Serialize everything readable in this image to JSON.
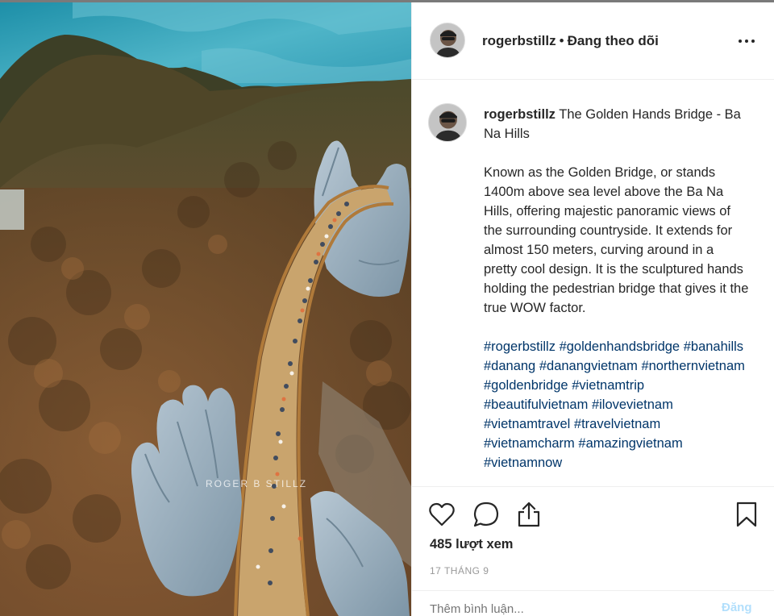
{
  "post": {
    "author": "rogerbstillz",
    "separator": "•",
    "follow_status": "Đang theo dõi",
    "watermark": "ROGER B STILLZ"
  },
  "caption": {
    "username": "rogerbstillz",
    "title": "The Golden Hands Bridge - Ba Na Hills",
    "body": "Known as the Golden Bridge, or stands 1400m above sea level above the Ba Na Hills, offering majestic panoramic views of the surrounding countryside. It extends for almost 150 meters, curving around in a pretty cool design. It is the sculptured hands holding the pedestrian bridge that gives it the true WOW factor.",
    "hashtags": [
      "#rogerbstillz",
      "#goldenhandsbridge",
      "#banahills",
      "#danang",
      "#danangvietnam",
      "#northernvietnam",
      "#goldenbridge",
      "#vietnamtrip",
      "#beautifulvietnam",
      "#ilovevietnam",
      "#vietnamtravel",
      "#travelvietnam",
      "#vietnamcharm",
      "#amazingvietnam",
      "#vietnamnow"
    ]
  },
  "actions": {
    "icons": [
      "heart-icon",
      "comment-icon",
      "share-icon",
      "bookmark-icon"
    ],
    "views": "485 lượt xem",
    "date": "17 THÁNG 9"
  },
  "comment": {
    "placeholder": "Thêm bình luận...",
    "post_label": "Đăng"
  }
}
